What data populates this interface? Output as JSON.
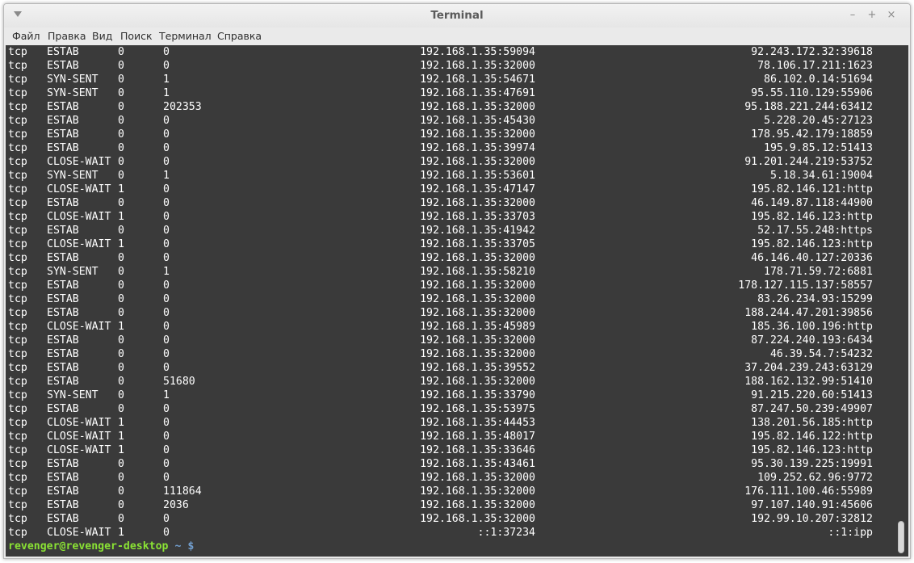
{
  "window": {
    "title": "Terminal",
    "controls": {
      "minimize": "–",
      "maximize": "+",
      "close": "×"
    }
  },
  "menu": [
    "Файл",
    "Правка",
    "Вид",
    "Поиск",
    "Терминал",
    "Справка"
  ],
  "rows": [
    [
      "tcp",
      "ESTAB",
      "0",
      "0",
      "192.168.1.35:59094",
      "92.243.172.32:39618"
    ],
    [
      "tcp",
      "ESTAB",
      "0",
      "0",
      "192.168.1.35:32000",
      "78.106.17.211:1623"
    ],
    [
      "tcp",
      "SYN-SENT",
      "0",
      "1",
      "192.168.1.35:54671",
      "86.102.0.14:51694"
    ],
    [
      "tcp",
      "SYN-SENT",
      "0",
      "1",
      "192.168.1.35:47691",
      "95.55.110.129:55906"
    ],
    [
      "tcp",
      "ESTAB",
      "0",
      "202353",
      "192.168.1.35:32000",
      "95.188.221.244:63412"
    ],
    [
      "tcp",
      "ESTAB",
      "0",
      "0",
      "192.168.1.35:45430",
      "5.228.20.45:27123"
    ],
    [
      "tcp",
      "ESTAB",
      "0",
      "0",
      "192.168.1.35:32000",
      "178.95.42.179:18859"
    ],
    [
      "tcp",
      "ESTAB",
      "0",
      "0",
      "192.168.1.35:39974",
      "195.9.85.12:51413"
    ],
    [
      "tcp",
      "CLOSE-WAIT",
      "0",
      "0",
      "192.168.1.35:32000",
      "91.201.244.219:53752"
    ],
    [
      "tcp",
      "SYN-SENT",
      "0",
      "1",
      "192.168.1.35:53601",
      "5.18.34.61:19004"
    ],
    [
      "tcp",
      "CLOSE-WAIT",
      "1",
      "0",
      "192.168.1.35:47147",
      "195.82.146.121:http"
    ],
    [
      "tcp",
      "ESTAB",
      "0",
      "0",
      "192.168.1.35:32000",
      "46.149.87.118:44900"
    ],
    [
      "tcp",
      "CLOSE-WAIT",
      "1",
      "0",
      "192.168.1.35:33703",
      "195.82.146.123:http"
    ],
    [
      "tcp",
      "ESTAB",
      "0",
      "0",
      "192.168.1.35:41942",
      "52.17.55.248:https"
    ],
    [
      "tcp",
      "CLOSE-WAIT",
      "1",
      "0",
      "192.168.1.35:33705",
      "195.82.146.123:http"
    ],
    [
      "tcp",
      "ESTAB",
      "0",
      "0",
      "192.168.1.35:32000",
      "46.146.40.127:20336"
    ],
    [
      "tcp",
      "SYN-SENT",
      "0",
      "1",
      "192.168.1.35:58210",
      "178.71.59.72:6881"
    ],
    [
      "tcp",
      "ESTAB",
      "0",
      "0",
      "192.168.1.35:32000",
      "178.127.115.137:58557"
    ],
    [
      "tcp",
      "ESTAB",
      "0",
      "0",
      "192.168.1.35:32000",
      "83.26.234.93:15299"
    ],
    [
      "tcp",
      "ESTAB",
      "0",
      "0",
      "192.168.1.35:32000",
      "188.244.47.201:39856"
    ],
    [
      "tcp",
      "CLOSE-WAIT",
      "1",
      "0",
      "192.168.1.35:45989",
      "185.36.100.196:http"
    ],
    [
      "tcp",
      "ESTAB",
      "0",
      "0",
      "192.168.1.35:32000",
      "87.224.240.193:6434"
    ],
    [
      "tcp",
      "ESTAB",
      "0",
      "0",
      "192.168.1.35:32000",
      "46.39.54.7:54232"
    ],
    [
      "tcp",
      "ESTAB",
      "0",
      "0",
      "192.168.1.35:39552",
      "37.204.239.243:63129"
    ],
    [
      "tcp",
      "ESTAB",
      "0",
      "51680",
      "192.168.1.35:32000",
      "188.162.132.99:51410"
    ],
    [
      "tcp",
      "SYN-SENT",
      "0",
      "1",
      "192.168.1.35:33790",
      "91.215.220.60:51413"
    ],
    [
      "tcp",
      "ESTAB",
      "0",
      "0",
      "192.168.1.35:53975",
      "87.247.50.239:49907"
    ],
    [
      "tcp",
      "CLOSE-WAIT",
      "1",
      "0",
      "192.168.1.35:44453",
      "138.201.56.185:http"
    ],
    [
      "tcp",
      "CLOSE-WAIT",
      "1",
      "0",
      "192.168.1.35:48017",
      "195.82.146.122:http"
    ],
    [
      "tcp",
      "CLOSE-WAIT",
      "1",
      "0",
      "192.168.1.35:33646",
      "195.82.146.123:http"
    ],
    [
      "tcp",
      "ESTAB",
      "0",
      "0",
      "192.168.1.35:43461",
      "95.30.139.225:19991"
    ],
    [
      "tcp",
      "ESTAB",
      "0",
      "0",
      "192.168.1.35:32000",
      "109.252.62.96:9772"
    ],
    [
      "tcp",
      "ESTAB",
      "0",
      "111864",
      "192.168.1.35:32000",
      "176.111.100.46:55989"
    ],
    [
      "tcp",
      "ESTAB",
      "0",
      "2036",
      "192.168.1.35:32000",
      "97.107.140.91:45606"
    ],
    [
      "tcp",
      "ESTAB",
      "0",
      "0",
      "192.168.1.35:32000",
      "192.99.10.207:32812"
    ],
    [
      "tcp",
      "CLOSE-WAIT",
      "1",
      "0",
      "::1:37234",
      "::1:ipp"
    ]
  ],
  "prompt": {
    "user_host": "revenger@revenger-desktop",
    "path": "~",
    "symbol": "$"
  },
  "colors": {
    "terminal_bg": "#3a3a3a",
    "terminal_fg": "#ffffff",
    "prompt_user": "#8ae234",
    "prompt_path": "#729fcf"
  }
}
